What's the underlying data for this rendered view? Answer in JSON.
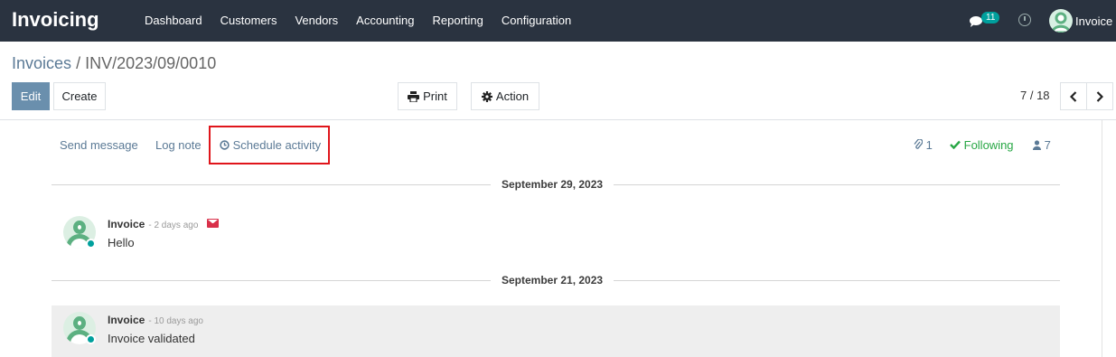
{
  "navbar": {
    "app_name": "Invoicing",
    "menu": [
      "Dashboard",
      "Customers",
      "Vendors",
      "Accounting",
      "Reporting",
      "Configuration"
    ],
    "messages_count": "11",
    "user_name": "Invoice"
  },
  "breadcrumb": {
    "parent": "Invoices",
    "separator": "/",
    "current": "INV/2023/09/0010"
  },
  "toolbar": {
    "edit_label": "Edit",
    "create_label": "Create",
    "print_label": "Print",
    "action_label": "Action",
    "pager": "7 / 18"
  },
  "chatter": {
    "send_message": "Send message",
    "log_note": "Log note",
    "schedule_activity": "Schedule activity",
    "attachments_count": "1",
    "following_label": "Following",
    "followers_count": "7"
  },
  "thread": [
    {
      "date": "September 29, 2023",
      "author": "Invoice",
      "ago": "- 2 days ago",
      "body": "Hello"
    },
    {
      "date": "September 21, 2023",
      "author": "Invoice",
      "ago": "- 10 days ago",
      "body": "Invoice validated"
    }
  ],
  "colors": {
    "navbar_bg": "#2a3340",
    "link": "#5b7a96",
    "edit_button": "#6a8fad",
    "highlight_box": "#e0151b",
    "following": "#28a745",
    "presence": "#00a09d"
  }
}
